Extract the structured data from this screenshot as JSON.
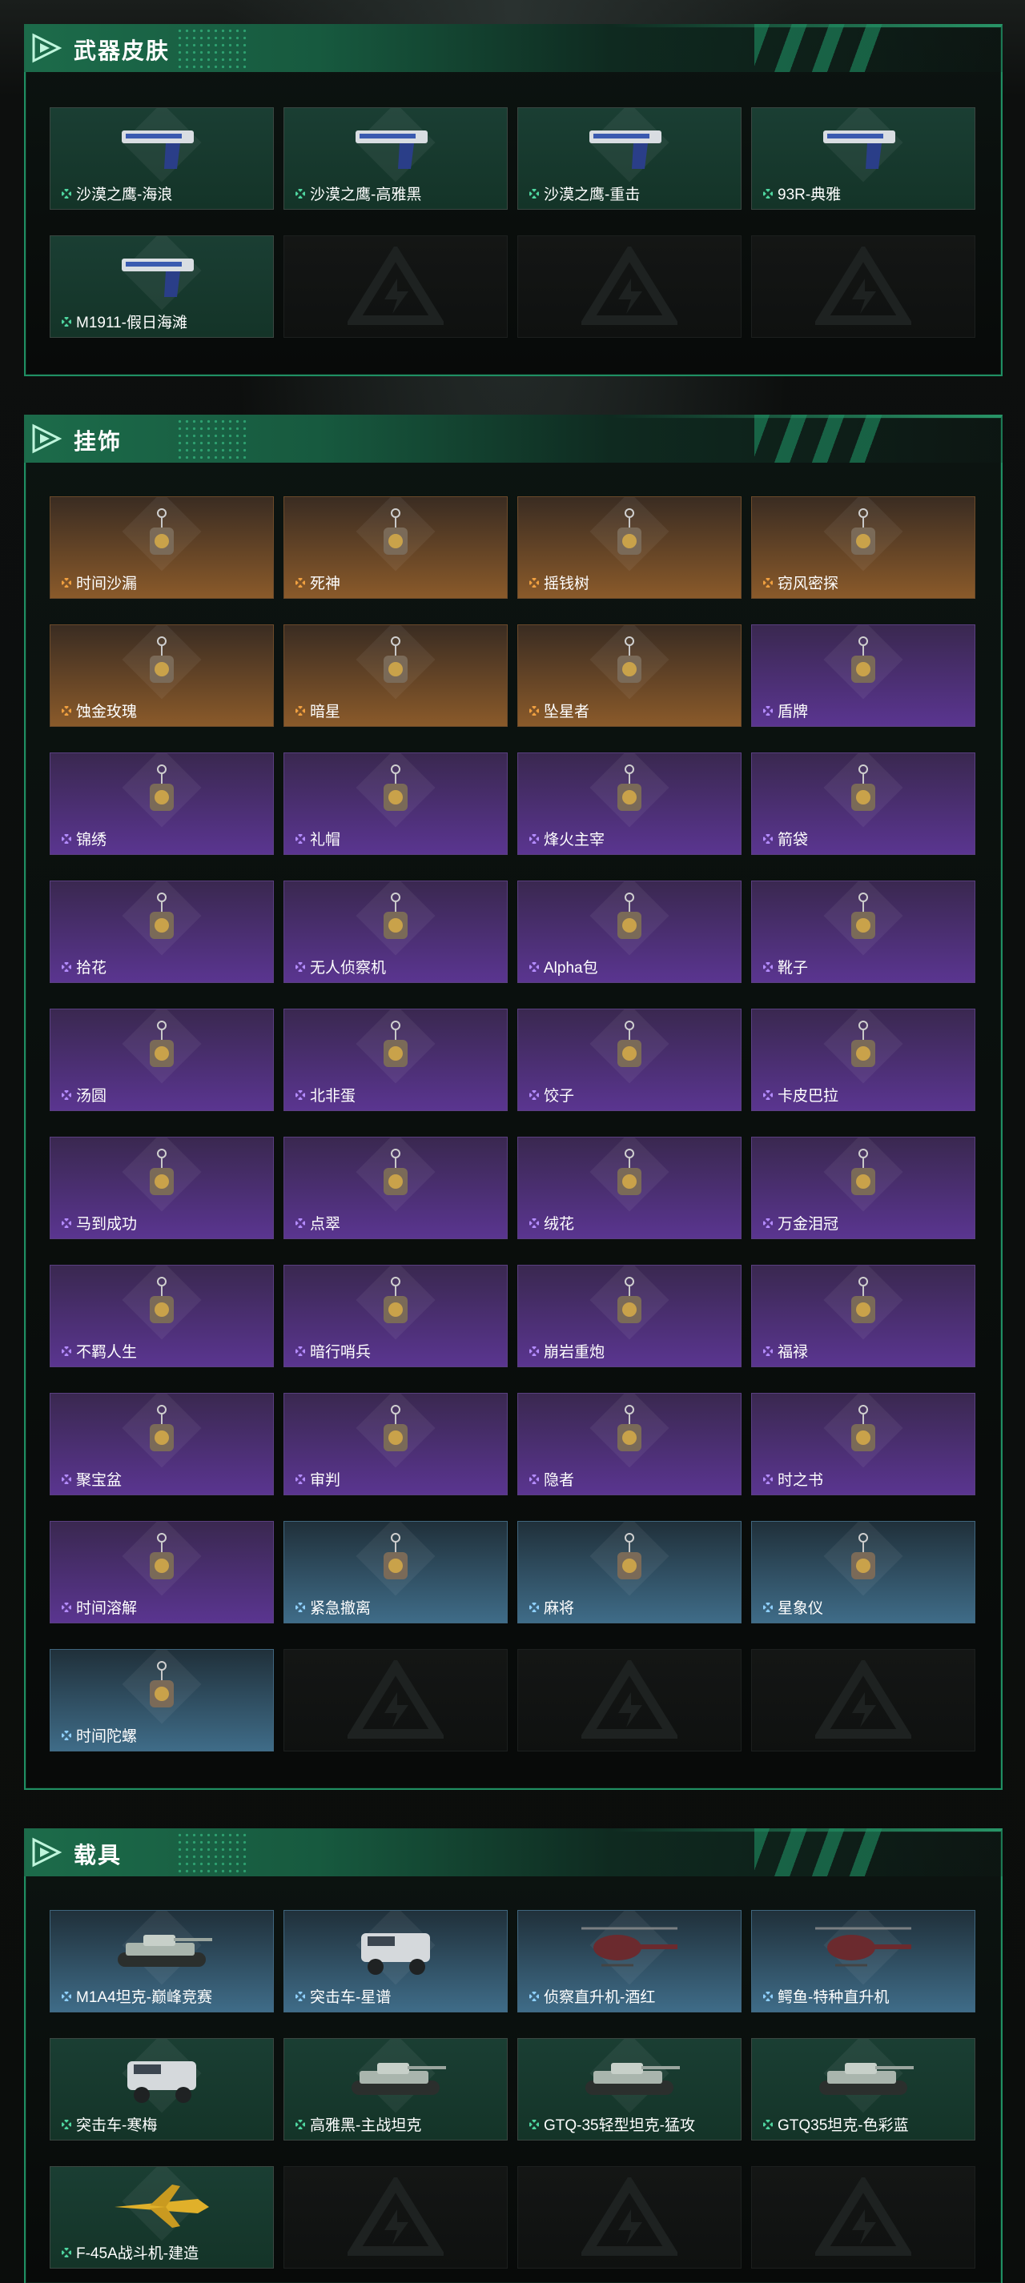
{
  "sections": {
    "weapons": {
      "title": "武器皮肤",
      "items": [
        {
          "name": "沙漠之鹰-海浪",
          "tier": "green",
          "icon": "pistol-icon"
        },
        {
          "name": "沙漠之鹰-高雅黑",
          "tier": "green",
          "icon": "pistol-icon"
        },
        {
          "name": "沙漠之鹰-重击",
          "tier": "green",
          "icon": "pistol-icon"
        },
        {
          "name": "93R-典雅",
          "tier": "green",
          "icon": "pistol-icon"
        },
        {
          "name": "M1911-假日海滩",
          "tier": "green",
          "icon": "pistol-icon"
        }
      ]
    },
    "charms": {
      "title": "挂饰",
      "items": [
        {
          "name": "时间沙漏",
          "tier": "orange",
          "icon": "charm-icon"
        },
        {
          "name": "死神",
          "tier": "orange",
          "icon": "charm-icon"
        },
        {
          "name": "摇钱树",
          "tier": "orange",
          "icon": "charm-icon"
        },
        {
          "name": "窃风密探",
          "tier": "orange",
          "icon": "charm-icon"
        },
        {
          "name": "蚀金玫瑰",
          "tier": "orange",
          "icon": "charm-icon"
        },
        {
          "name": "暗星",
          "tier": "orange",
          "icon": "charm-icon"
        },
        {
          "name": "坠星者",
          "tier": "orange",
          "icon": "charm-icon"
        },
        {
          "name": "盾牌",
          "tier": "purple",
          "icon": "charm-icon"
        },
        {
          "name": "锦绣",
          "tier": "purple",
          "icon": "charm-icon"
        },
        {
          "name": "礼帽",
          "tier": "purple",
          "icon": "charm-icon"
        },
        {
          "name": "烽火主宰",
          "tier": "purple",
          "icon": "charm-icon"
        },
        {
          "name": "箭袋",
          "tier": "purple",
          "icon": "charm-icon"
        },
        {
          "name": "拾花",
          "tier": "purple",
          "icon": "charm-icon"
        },
        {
          "name": "无人侦察机",
          "tier": "purple",
          "icon": "charm-icon"
        },
        {
          "name": "Alpha包",
          "tier": "purple",
          "icon": "charm-icon"
        },
        {
          "name": "靴子",
          "tier": "purple",
          "icon": "charm-icon"
        },
        {
          "name": "汤圆",
          "tier": "purple",
          "icon": "charm-icon"
        },
        {
          "name": "北非蛋",
          "tier": "purple",
          "icon": "charm-icon"
        },
        {
          "name": "饺子",
          "tier": "purple",
          "icon": "charm-icon"
        },
        {
          "name": "卡皮巴拉",
          "tier": "purple",
          "icon": "charm-icon"
        },
        {
          "name": "马到成功",
          "tier": "purple",
          "icon": "charm-icon"
        },
        {
          "name": "点翠",
          "tier": "purple",
          "icon": "charm-icon"
        },
        {
          "name": "绒花",
          "tier": "purple",
          "icon": "charm-icon"
        },
        {
          "name": "万金泪冠",
          "tier": "purple",
          "icon": "charm-icon"
        },
        {
          "name": "不羁人生",
          "tier": "purple",
          "icon": "charm-icon"
        },
        {
          "name": "暗行哨兵",
          "tier": "purple",
          "icon": "charm-icon"
        },
        {
          "name": "崩岩重炮",
          "tier": "purple",
          "icon": "charm-icon"
        },
        {
          "name": "福禄",
          "tier": "purple",
          "icon": "charm-icon"
        },
        {
          "name": "聚宝盆",
          "tier": "purple",
          "icon": "charm-icon"
        },
        {
          "name": "审判",
          "tier": "purple",
          "icon": "charm-icon"
        },
        {
          "name": "隐者",
          "tier": "purple",
          "icon": "charm-icon"
        },
        {
          "name": "时之书",
          "tier": "purple",
          "icon": "charm-icon"
        },
        {
          "name": "时间溶解",
          "tier": "purple",
          "icon": "charm-icon"
        },
        {
          "name": "紧急撤离",
          "tier": "blue",
          "icon": "charm-icon"
        },
        {
          "name": "麻将",
          "tier": "blue",
          "icon": "charm-icon"
        },
        {
          "name": "星象仪",
          "tier": "blue",
          "icon": "charm-icon"
        },
        {
          "name": "时间陀螺",
          "tier": "blue",
          "icon": "charm-icon"
        }
      ]
    },
    "vehicles": {
      "title": "载具",
      "items": [
        {
          "name": "M1A4坦克-巅峰竞赛",
          "tier": "blue",
          "icon": "tank-icon"
        },
        {
          "name": "突击车-星谱",
          "tier": "blue",
          "icon": "truck-icon"
        },
        {
          "name": "侦察直升机-酒红",
          "tier": "blue",
          "icon": "helicopter-icon"
        },
        {
          "name": "鳄鱼-特种直升机",
          "tier": "blue",
          "icon": "helicopter-icon"
        },
        {
          "name": "突击车-寒梅",
          "tier": "green",
          "icon": "truck-icon"
        },
        {
          "name": "高雅黑-主战坦克",
          "tier": "green",
          "icon": "tank-icon"
        },
        {
          "name": "GTQ-35轻型坦克-猛攻",
          "tier": "green",
          "icon": "tank-icon"
        },
        {
          "name": "GTQ35坦克-色彩蓝",
          "tier": "green",
          "icon": "tank-icon"
        },
        {
          "name": "F-45A战斗机-建造",
          "tier": "green",
          "icon": "jet-icon"
        }
      ]
    }
  },
  "colors": {
    "accent": "#2fb37c",
    "green_tier": "#4fd6a0",
    "orange_tier": "#f0a040",
    "purple_tier": "#b48cff",
    "blue_tier": "#8fd0ff"
  }
}
